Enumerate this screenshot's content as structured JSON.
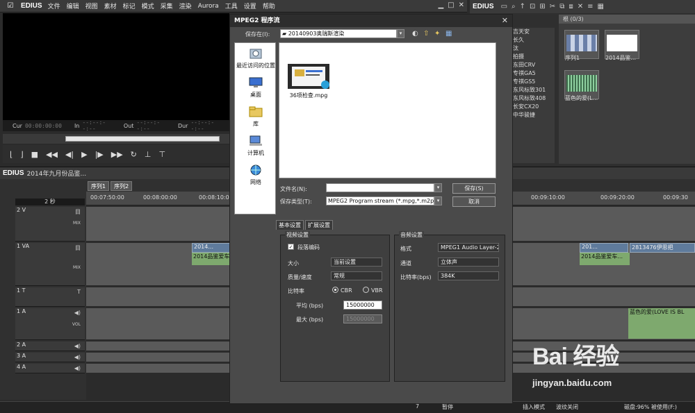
{
  "menu": {
    "brand": "EDIUS",
    "items": [
      "文件",
      "编辑",
      "视图",
      "素材",
      "标记",
      "模式",
      "采集",
      "渲染",
      "Aurora",
      "工具",
      "设置",
      "帮助"
    ]
  },
  "player": {
    "cur_label": "Cur",
    "cur_value": "00:00:00:00",
    "in_label": "In",
    "in_value": "--:--:--:--",
    "out_label": "Out",
    "out_value": "--:--:--:--",
    "dur_label": "Dur",
    "dur_value": "--:--:--:--"
  },
  "bin": {
    "brand": "EDIUS",
    "folders": [
      "吉天安",
      "长久",
      "汰",
      "拍摄",
      "东田CRV",
      "专祺GA5",
      "专祺GS5",
      "东风标致301",
      "东风标致408",
      "长安CX20",
      "中华骏捷"
    ],
    "header": "根 (0/3)",
    "clips": [
      {
        "label": "序列1",
        "kind": "sequence"
      },
      {
        "label": "2014品鉴...",
        "kind": "white"
      },
      {
        "label": "蓝色的爱(L...",
        "kind": "audio"
      }
    ]
  },
  "timeline": {
    "brand": "EDIUS",
    "project": "2014年九月份品鉴...",
    "seq_tabs": [
      "序列1",
      "序列2"
    ],
    "scale": "2 秒",
    "ruler": [
      "00:07:50:00",
      "00:08:00:00",
      "00:08:10:00",
      "00:09:10:00",
      "00:09:20:00",
      "00:09:30"
    ],
    "tracks": [
      {
        "name": "2 V",
        "icon": "目",
        "mix": "MIX"
      },
      {
        "name": "1 VA",
        "icon": "目",
        "mix": "MIX"
      },
      {
        "name": "1 T",
        "icon": "T",
        "mix": ""
      },
      {
        "name": "1 A",
        "icon": "◀)",
        "mix": "VOL"
      },
      {
        "name": "2 A",
        "icon": "◀)",
        "mix": ""
      },
      {
        "name": "3 A",
        "icon": "◀)",
        "mix": ""
      },
      {
        "name": "4 A",
        "icon": "◀)",
        "mix": ""
      }
    ],
    "clips": {
      "v1_left_top": "2014...",
      "v1_left_bottom": "2014品鉴爱车...",
      "v1_right_a": "201...",
      "v1_right_b": "2813476伊思把",
      "v1_right_bottom": "2014品鉴爱车...",
      "a1": "蓝色的爱(LOVE IS BL"
    }
  },
  "status": {
    "zoom": "7",
    "pause": "暂停",
    "insert": "插入模式",
    "ripple": "波纹关闭",
    "disk": "磁盘:96% 被使用(F:)"
  },
  "dialog": {
    "title": "MPEG2 程序流",
    "save_in_label": "保存在(I):",
    "save_in_value": "20140903奥瑞斯渲染",
    "places": [
      "最近访问的位置",
      "桌面",
      "库",
      "计算机",
      "网络"
    ],
    "file_name": "36项检查.mpg",
    "filename_label": "文件名(N):",
    "filename_value": "",
    "filetype_label": "保存类型(T):",
    "filetype_value": "MPEG2 Program stream (*.mpg,*.m2p)",
    "save_button": "保存(S)",
    "cancel_button": "取消",
    "tabs": [
      "基本设置",
      "扩展设置"
    ],
    "video": {
      "title": "视频设置",
      "segment_encoding": "段落编码",
      "size_label": "大小",
      "size_value": "当前设置",
      "quality_label": "质量/速度",
      "quality_value": "常规",
      "bitrate_label": "比特率",
      "cbr": "CBR",
      "vbr": "VBR",
      "avg_label": "平均 (bps)",
      "avg_value": "15000000",
      "max_label": "最大 (bps)",
      "max_value": "15000000"
    },
    "audio": {
      "title": "音频设置",
      "format_label": "格式",
      "format_value": "MPEG1 Audio Layer-2",
      "channel_label": "通道",
      "channel_value": "立体声",
      "bitrate_label": "比特率(bps)",
      "bitrate_value": "384K"
    }
  },
  "watermark": {
    "brand": "Bai 经验",
    "url": "jingyan.baidu.com"
  }
}
